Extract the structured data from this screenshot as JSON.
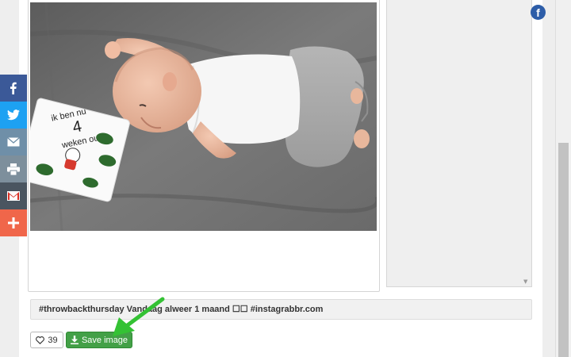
{
  "post": {
    "caption": "#throwbackthursday Vandaag alweer 1 maand ☐☐ #instagrabbr.com",
    "likes": "39",
    "save_label": "Save image",
    "milestone_card": {
      "line1": "ik ben nu",
      "number": "4",
      "line2": "weken oud"
    }
  },
  "share_bar": {
    "items": [
      {
        "icon": "facebook-icon",
        "color": "#3b5998"
      },
      {
        "icon": "twitter-icon",
        "color": "#1da1f2"
      },
      {
        "icon": "mail-icon",
        "color": "#6f8fa8"
      },
      {
        "icon": "print-icon",
        "color": "#7d8f9c"
      },
      {
        "icon": "gmail-icon",
        "color": "#4a5560"
      },
      {
        "icon": "plus-icon",
        "color": "#f0664a"
      }
    ]
  },
  "corner_icon": {
    "icon": "facebook-icon",
    "glyph": "f",
    "color": "#2d5da8"
  },
  "colors": {
    "save_button": "#43a047",
    "annotation_arrow": "#34c234"
  }
}
